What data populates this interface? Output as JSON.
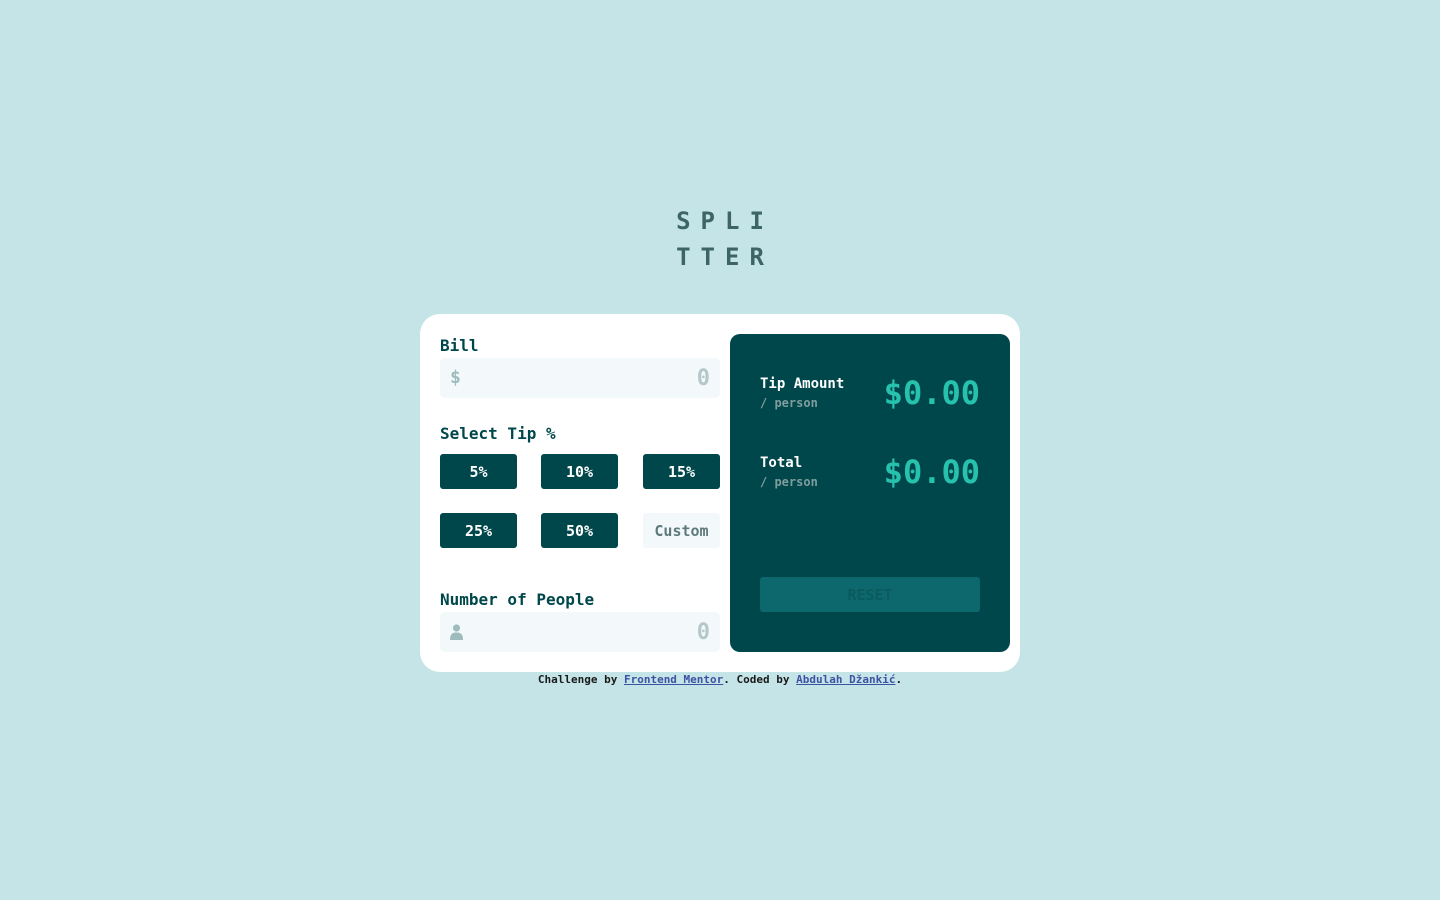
{
  "logo": {
    "line1": "SPLI",
    "line2": "TTER"
  },
  "bill": {
    "label": "Bill",
    "prefix_icon": "dollar-icon",
    "prefix_symbol": "$",
    "placeholder": "0"
  },
  "tip": {
    "label": "Select Tip %",
    "options": [
      "5%",
      "10%",
      "15%",
      "25%",
      "50%"
    ],
    "custom_placeholder": "Custom"
  },
  "people": {
    "label": "Number of People",
    "icon": "person-icon",
    "placeholder": "0"
  },
  "results": {
    "tip_amount": {
      "title": "Tip Amount",
      "subtitle": "/ person",
      "value": "$0.00"
    },
    "total": {
      "title": "Total",
      "subtitle": "/ person",
      "value": "$0.00"
    },
    "reset_label": "RESET"
  },
  "attribution": {
    "prefix": "Challenge by ",
    "link1": "Frontend Mentor",
    "middle": ". Coded by ",
    "link2": "Abdulah Džankić",
    "suffix": "."
  },
  "colors": {
    "background": "#c5e4e7",
    "card": "#ffffff",
    "dark_teal": "#00474b",
    "accent": "#26c2ae",
    "input_bg": "#f3f9fa"
  }
}
